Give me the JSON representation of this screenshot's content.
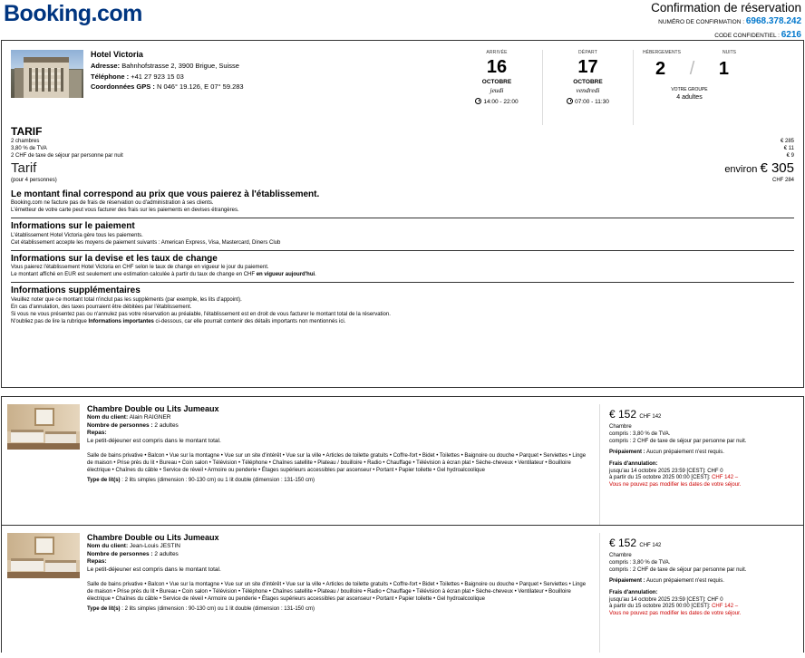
{
  "header": {
    "logo": "Booking",
    "logo_suffix": ".com",
    "confirmation_title": "Confirmation de réservation",
    "confirmation_number_label": "NUMÉRO DE CONFIRMATION :",
    "confirmation_number": "6968.378.242",
    "code_label": "CODE CONFIDENTIEL :",
    "code": "6216"
  },
  "hotel": {
    "name": "Hotel Victoria",
    "address_label": "Adresse:",
    "address": "Bahnhofstrasse 2, 3900 Brigue, Suisse",
    "phone_label": "Téléphone :",
    "phone": "+41 27 923 15 03",
    "gps_label": "Coordonnées GPS :",
    "gps": "N 046° 19.126, E 07° 59.283"
  },
  "arrival": {
    "label": "ARRIVÉE",
    "day": "16",
    "month": "OCTOBRE",
    "weekday": "jeudi",
    "time": "14:00 - 22:00"
  },
  "departure": {
    "label": "DÉPART",
    "day": "17",
    "month": "OCTOBRE",
    "weekday": "vendredi",
    "time": "07:00 - 11:30"
  },
  "stay": {
    "rooms_label": "HÉBERGEMENTS",
    "nights_label": "NUITS",
    "rooms": "2",
    "nights": "1",
    "group_label": "VOTRE GROUPE",
    "group": "4 adultes"
  },
  "tarif": {
    "title": "TARIF",
    "lines": [
      {
        "label": "2 chambres",
        "value": "€ 285"
      },
      {
        "label": "3,80 % de TVA",
        "value": "€ 11"
      },
      {
        "label": "2 CHF de taxe de séjour par personne par nuit",
        "value": "€ 9"
      }
    ],
    "total_label": "Tarif",
    "total_prefix": "environ",
    "total": "€ 305",
    "persons": "(pour 4 personnes)",
    "total_chf": "CHF 284"
  },
  "final": {
    "heading": "Le montant final correspond au prix que vous paierez à l'établissement.",
    "lines": [
      "Booking.com ne facture pas de frais de réservation ou d'administration à ses clients.",
      "L'émetteur de votre carte peut vous facturer des frais sur les paiements en devises étrangères."
    ]
  },
  "payment": {
    "heading": "Informations sur le paiement",
    "lines": [
      "L'établissement Hotel Victoria gère tous les paiements.",
      "Cet établissement accepte les moyens de paiement suivants : American Express, Visa, Mastercard, Diners Club"
    ]
  },
  "currency": {
    "heading": "Informations sur la devise et les taux de change",
    "line1": "Vous paierez l'établissement Hotel Victoria en CHF selon le taux de change en vigueur le jour du paiement.",
    "line2": "Le montant affiché en EUR est seulement une estimation calculée à partir du taux de change en CHF ",
    "line2_bold": "en vigueur aujourd'hui",
    "line2_end": "."
  },
  "supplementary": {
    "heading": "Informations supplémentaires",
    "line1": "Veuillez noter que ce montant total n'inclut pas les suppléments (par exemple, les lits d'appoint).",
    "line2": "En cas d'annulation, des taxes pourraient être débitées par l'établissement.",
    "line3": "Si vous ne vous présentez pas ou n'annulez pas votre réservation au préalable, l'établissement est en droit de vous facturer le montant total de la réservation.",
    "line4": "N'oubliez pas de lire la rubrique ",
    "line4_bold": "Informations importantes",
    "line4_end": " ci-dessous, car elle pourrait contenir des détails importants non mentionnés ici."
  },
  "rooms": [
    {
      "name": "Chambre Double ou Lits Jumeaux",
      "client_label": "Nom du client:",
      "client": "Alain RAIGNER",
      "persons_label": "Nombre de personnes :",
      "persons": "2 adultes",
      "meals_label": "Repas:",
      "meals": "Le petit-déjeuner est compris dans le montant total.",
      "facilities": "Salle de bains privative • Balcon • Vue sur la montagne • Vue sur un site d'intérêt • Vue sur la ville • Articles de toilette gratuits • Coffre-fort • Bidet • Toilettes • Baignoire ou douche • Parquet • Serviettes • Linge de maison • Prise près du lit • Bureau • Coin salon • Télévision • Téléphone • Chaînes satellite • Plateau / bouilloire • Radio • Chauffage • Télévision à écran plat • Sèche-cheveux • Ventilateur • Bouilloire électrique • Chaînes du câble • Service de réveil • Armoire ou penderie • Étages supérieurs accessibles par ascenseur • Portant • Papier toilette • Gel hydroalcoolique",
      "beds_label": "Type de lit(s)",
      "beds": " : 2 lits simples (dimension : 90-130 cm) ou 1 lit double (dimension : 131-150 cm)",
      "price": "€ 152",
      "price_chf": "CHF 142",
      "price_lines": [
        "Chambre",
        "compris : 3,80 % de TVA.",
        "compris : 2 CHF de taxe de séjour par personne par nuit."
      ],
      "prepay_label": "Prépaiement :",
      "prepay": "Aucun prépaiement n'est requis.",
      "cancel_label": "Frais d'annulation:",
      "cancel1": "jusqu'au 14 octobre 2025 23:59 [CEST]: CHF 0",
      "cancel2": "à partir du 15 octobre 2025 00:00 [CEST]: ",
      "cancel2_red": "CHF 142 –",
      "cancel3": "Vous ne pouvez pas modifier les dates de votre séjour."
    },
    {
      "name": "Chambre Double ou Lits Jumeaux",
      "client_label": "Nom du client:",
      "client": "Jean-Louis JESTIN",
      "persons_label": "Nombre de personnes :",
      "persons": "2 adultes",
      "meals_label": "Repas:",
      "meals": "Le petit-déjeuner est compris dans le montant total.",
      "facilities": "Salle de bains privative • Balcon • Vue sur la montagne • Vue sur un site d'intérêt • Vue sur la ville • Articles de toilette gratuits • Coffre-fort • Bidet • Toilettes • Baignoire ou douche • Parquet • Serviettes • Linge de maison • Prise près du lit • Bureau • Coin salon • Télévision • Téléphone • Chaînes satellite • Plateau / bouilloire • Radio • Chauffage • Télévision à écran plat • Sèche-cheveux • Ventilateur • Bouilloire électrique • Chaînes du câble • Service de réveil • Armoire ou penderie • Étages supérieurs accessibles par ascenseur • Portant • Papier toilette • Gel hydroalcoolique",
      "beds_label": "Type de lit(s)",
      "beds": " : 2 lits simples (dimension : 90-130 cm) ou 1 lit double (dimension : 131-150 cm)",
      "price": "€ 152",
      "price_chf": "CHF 142",
      "price_lines": [
        "Chambre",
        "compris : 3,80 % de TVA.",
        "compris : 2 CHF de taxe de séjour par personne par nuit."
      ],
      "prepay_label": "Prépaiement :",
      "prepay": "Aucun prépaiement n'est requis.",
      "cancel_label": "Frais d'annulation:",
      "cancel1": "jusqu'au 14 octobre 2025 23:59 [CEST]: CHF 0",
      "cancel2": "à partir du 15 octobre 2025 00:00 [CEST]: ",
      "cancel2_red": "CHF 142 –",
      "cancel3": "Vous ne pouvez pas modifier les dates de votre séjour."
    }
  ]
}
